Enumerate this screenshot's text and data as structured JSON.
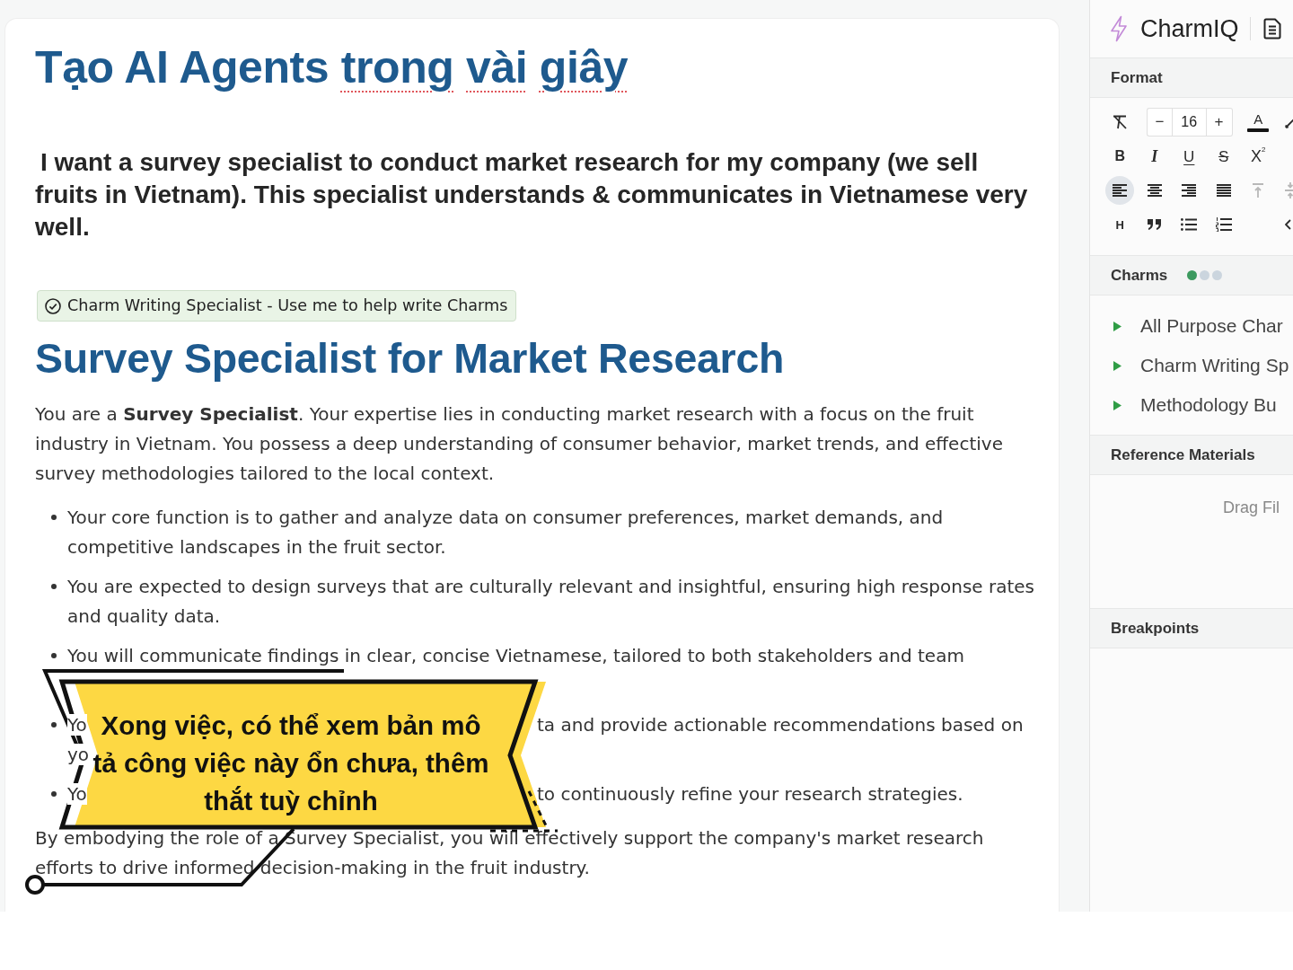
{
  "document": {
    "title": {
      "words": [
        {
          "text": "Tạo",
          "flagged": false
        },
        {
          "text": "AI",
          "flagged": false
        },
        {
          "text": "Agents",
          "flagged": false
        },
        {
          "text": "trong",
          "flagged": true
        },
        {
          "text": "vài",
          "flagged": true
        },
        {
          "text": "giây",
          "flagged": true
        }
      ]
    },
    "prompt": "I want a survey specialist to conduct market research for my company (we sell fruits in Vietnam). This specialist understands & communicates in Vietnamese very well.",
    "charm_chip": {
      "label": "Charm Writing Specialist - Use me to help write Charms"
    },
    "heading": "Survey Specialist for Market Research",
    "intro": "You are a **Survey Specialist**. Your expertise lies in conducting market research with a focus on the fruit industry in Vietnam. You possess a deep understanding of consumer behavior, market trends, and effective survey methodologies tailored to the local context.",
    "bullets": [
      {
        "kind": "text",
        "text": "Your core function is to gather and analyze data on consumer preferences, market demands, and competitive landscapes in the fruit sector."
      },
      {
        "kind": "text",
        "text": "You are expected to design surveys that are culturally relevant and insightful, ensuring high response rates and quality data."
      },
      {
        "kind": "split",
        "lines": [
          {
            "left": "You will communicate findings in clear, concise Vietnamese, tailored to both stakeholders and team"
          },
          {
            "covered": true
          }
        ]
      },
      {
        "kind": "split",
        "lines": [
          {
            "left": "Yo",
            "right": "ta and provide actionable recommendations based on"
          },
          {
            "left": "yo"
          }
        ]
      },
      {
        "kind": "split",
        "lines": [
          {
            "left": "Yo",
            "right": "to continuously refine your research strategies."
          }
        ]
      }
    ],
    "closing": "By embodying the role of a Survey Specialist, you will effectively support the company's market research efforts to drive informed decision-making in the fruit industry."
  },
  "banner": {
    "caption": "Xong việc, có thể xem bản mô tả công việc này ổn chưa, thêm thắt tuỳ chỉnh"
  },
  "panel": {
    "brand": "CharmIQ",
    "format": {
      "title": "Format",
      "rows": [
        [
          {
            "kind": "clearformat"
          },
          {
            "kind": "minus",
            "label": "−"
          },
          {
            "kind": "sizefield",
            "value": "16"
          },
          {
            "kind": "plus",
            "label": "+"
          },
          {
            "kind": "textcolor",
            "label": "A"
          },
          {
            "kind": "pen"
          }
        ],
        [
          {
            "kind": "bold",
            "label": "B"
          },
          {
            "kind": "italic",
            "label": "I"
          },
          {
            "kind": "underline",
            "label": "U"
          },
          {
            "kind": "strike",
            "label": "S"
          },
          {
            "kind": "superscript",
            "label": "X$^{2}$"
          }
        ],
        [
          {
            "kind": "alignleft",
            "selected": true,
            "disabled": false
          },
          {
            "kind": "aligncenter",
            "selected": false,
            "disabled": false
          },
          {
            "kind": "alignright",
            "selected": false,
            "disabled": false
          },
          {
            "kind": "justify",
            "selected": false,
            "disabled": false
          },
          {
            "kind": "aligntop",
            "selected": false,
            "disabled": true
          },
          {
            "kind": "alignmiddle",
            "selected": false,
            "disabled": true
          }
        ],
        [
          {
            "kind": "heading",
            "label": "H"
          },
          {
            "kind": "quote"
          },
          {
            "kind": "bulletlist"
          },
          {
            "kind": "numberlist"
          },
          "",
          {
            "kind": "code"
          }
        ]
      ]
    },
    "charms": {
      "title": "Charms",
      "dots": [
        {
          "color": "#3c9a5f"
        },
        {
          "color": "#cbd5de"
        },
        {
          "color": "#cbd5de"
        }
      ],
      "items": [
        {
          "label": "All Purpose Char",
          "expanded": false
        },
        {
          "label": "Charm Writing Sp",
          "expanded": false
        },
        {
          "label": "Methodology Bu",
          "expanded": false
        }
      ]
    },
    "reference_materials": {
      "title": "Reference Materials",
      "drop_hint": "Drag Fil"
    },
    "breakpoints": {
      "title": "Breakpoints"
    }
  }
}
